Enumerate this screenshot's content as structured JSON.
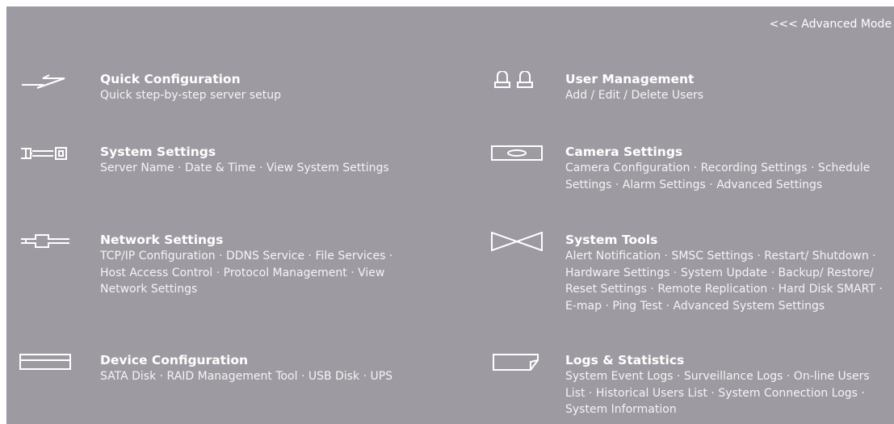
{
  "advanced_mode_label": "<<< Advanced Mode",
  "items": [
    {
      "title": "Quick Configuration",
      "desc": "Quick step-by-step server setup",
      "icon": "lightning-icon"
    },
    {
      "title": "User Management",
      "desc": "Add / Edit / Delete Users",
      "icon": "users-icon"
    },
    {
      "title": "System Settings",
      "desc": "Server Name · Date & Time · View System Settings",
      "icon": "system-connector-icon"
    },
    {
      "title": "Camera Settings",
      "desc": "Camera Configuration · Recording Settings · Schedule Settings · Alarm Settings · Advanced Settings",
      "icon": "camera-icon"
    },
    {
      "title": "Network Settings",
      "desc": "TCP/IP Configuration · DDNS Service · File Services · Host Access Control · Protocol Management · View Network Settings",
      "icon": "network-icon"
    },
    {
      "title": "System Tools",
      "desc": "Alert Notification · SMSC Settings · Restart/ Shutdown · Hardware Settings · System Update · Backup/ Restore/ Reset Settings · Remote Replication · Hard Disk SMART · E-map · Ping Test · Advanced System Settings",
      "icon": "tools-icon"
    },
    {
      "title": "Device Configuration",
      "desc": "SATA Disk · RAID Management Tool · USB Disk · UPS",
      "icon": "disk-drive-icon"
    },
    {
      "title": "Logs & Statistics",
      "desc": "System Event Logs · Surveillance Logs · On-line Users List · Historical Users List · System Connection Logs · System Information",
      "icon": "log-card-icon"
    }
  ]
}
